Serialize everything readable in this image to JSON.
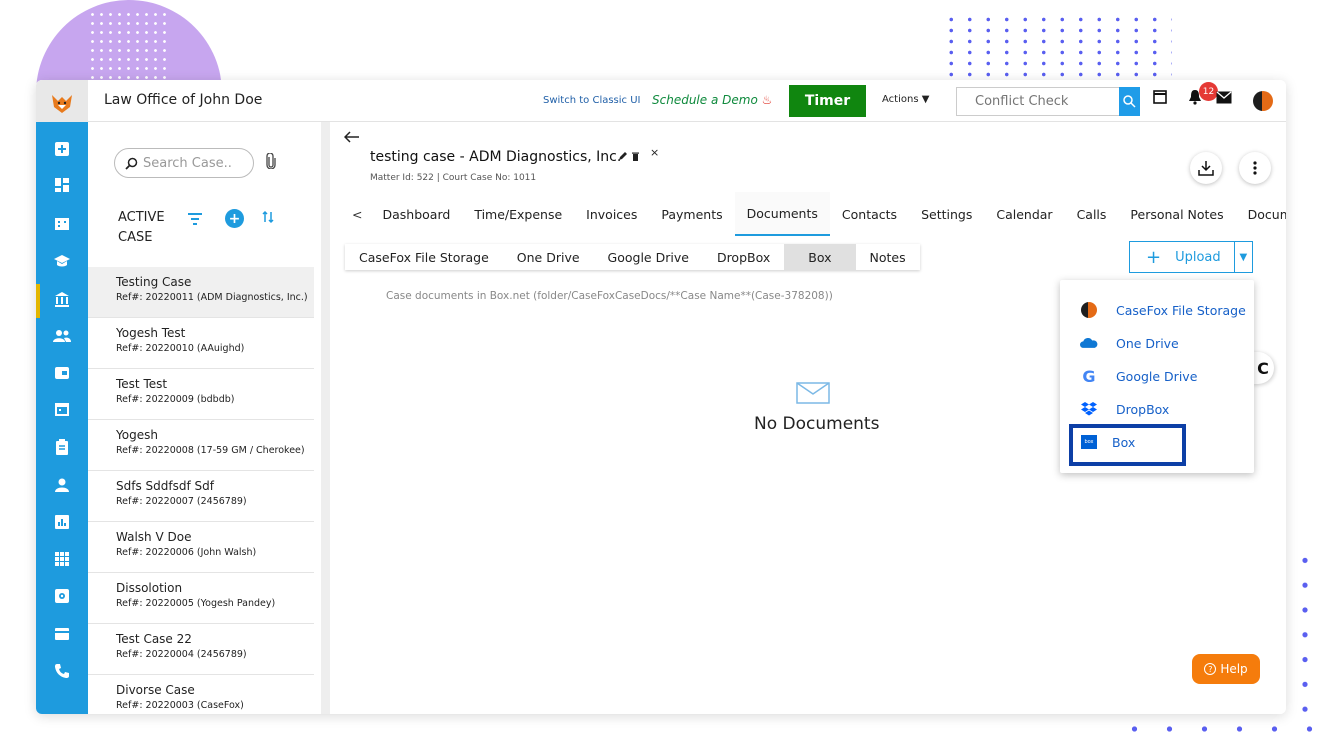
{
  "topbar": {
    "firm_name": "Law Office of John Doe",
    "classic_link": "Switch to Classic UI",
    "demo_link": "Schedule a Demo",
    "timer_label": "Timer",
    "actions_label": "Actions",
    "conflict_placeholder": "Conflict Check",
    "notification_count": "12"
  },
  "caselist": {
    "search_placeholder": "Search Case..",
    "header_line1": "ACTIVE",
    "header_line2": "CASE",
    "items": [
      {
        "title": "Testing Case",
        "ref": "Ref#: 20220011 (ADM Diagnostics, Inc.)"
      },
      {
        "title": "Yogesh Test",
        "ref": "Ref#: 20220010 (AAuighd)"
      },
      {
        "title": "Test Test",
        "ref": "Ref#: 20220009 (bdbdb)"
      },
      {
        "title": "Yogesh",
        "ref": "Ref#: 20220008 (17-59 GM / Cherokee)"
      },
      {
        "title": "Sdfs Sddfsdf Sdf",
        "ref": "Ref#: 20220007 (2456789)"
      },
      {
        "title": "Walsh V Doe",
        "ref": "Ref#: 20220006 (John Walsh)"
      },
      {
        "title": "Dissolotion",
        "ref": "Ref#: 20220005 (Yogesh Pandey)"
      },
      {
        "title": "Test Case 22",
        "ref": "Ref#: 20220004 (2456789)"
      },
      {
        "title": "Divorse Case",
        "ref": "Ref#: 20220003 (CaseFox)"
      }
    ]
  },
  "matter": {
    "title": "testing case - ADM Diagnostics, Inc.",
    "subtitle": "Matter Id: 522 | Court Case No: 1011"
  },
  "tabs": [
    "Dashboard",
    "Time/Expense",
    "Invoices",
    "Payments",
    "Documents",
    "Contacts",
    "Settings",
    "Calendar",
    "Calls",
    "Personal Notes",
    "Document"
  ],
  "subtabs": [
    "CaseFox File Storage",
    "One Drive",
    "Google Drive",
    "DropBox",
    "Box",
    "Notes"
  ],
  "upload": {
    "label": "Upload"
  },
  "doc_path": "Case documents in Box.net (folder/CaseFoxCaseDocs/**Case Name**(Case-378208))",
  "empty_state": "No Documents",
  "upload_menu": [
    {
      "label": "CaseFox File Storage",
      "icon": "casefox-icon"
    },
    {
      "label": "One Drive",
      "icon": "onedrive-icon"
    },
    {
      "label": "Google Drive",
      "icon": "google-drive-icon"
    },
    {
      "label": "DropBox",
      "icon": "dropbox-icon"
    },
    {
      "label": "Box",
      "icon": "box-icon"
    }
  ],
  "help_label": "Help",
  "colors": {
    "accent": "#1e9bde",
    "timer": "#10860f",
    "help": "#f57c0c",
    "highlight": "#0d3fa6"
  }
}
